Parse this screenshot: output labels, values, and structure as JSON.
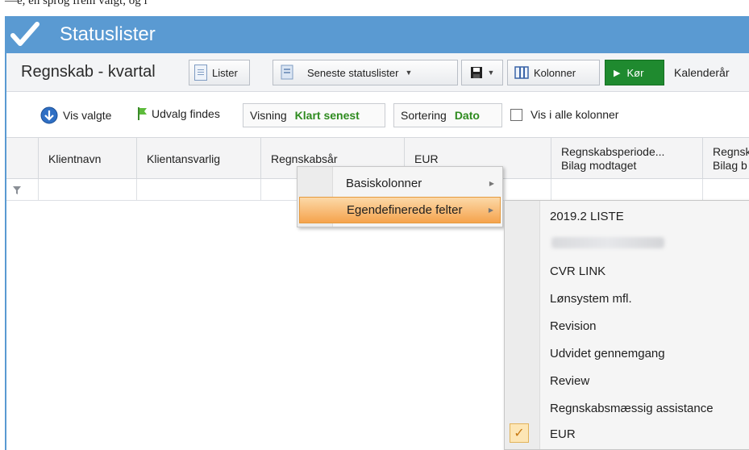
{
  "top_strip_text": "—e, en sprog frem valgt, og i",
  "window": {
    "title": "Statuslister"
  },
  "toolbar": {
    "view_title": "Regnskab - kvartal",
    "lister_label": "Lister",
    "seneste_label": "Seneste statuslister",
    "kolonner_label": "Kolonner",
    "run_label": "Kør",
    "kalender_label": "Kalenderår"
  },
  "filterbar": {
    "vis_valgte": "Vis valgte",
    "udvalg_findes": "Udvalg findes",
    "visning_label": "Visning",
    "visning_value": "Klart senest",
    "sortering_label": "Sortering",
    "sortering_value": "Dato",
    "vis_i_alle": "Vis i alle kolonner"
  },
  "grid": {
    "columns": [
      "Klientnavn",
      "Klientansvarlig",
      "Regnskabsår",
      "EUR"
    ],
    "col5_line1": "Regnskabsperiode...",
    "col5_line2": "Bilag modtaget",
    "col6_line1": "Regnsk",
    "col6_line2": "Bilag b"
  },
  "context_menu": {
    "items": [
      "Basiskolonner",
      "Egendefinerede felter"
    ],
    "highlighted_index": 1
  },
  "submenu": {
    "items": [
      "2019.2 LISTE",
      "",
      "CVR LINK",
      "Lønsystem mfl.",
      "Revision",
      "Udvidet gennemgang",
      "Review",
      "Regnskabsmæssig assistance",
      "EUR"
    ],
    "checked_item": "EUR"
  },
  "colors": {
    "titlebar": "#5a9ad2",
    "run_button": "#1f8a2f",
    "menu_highlight": "#f5a34d",
    "green_value": "#2e8b1f"
  }
}
